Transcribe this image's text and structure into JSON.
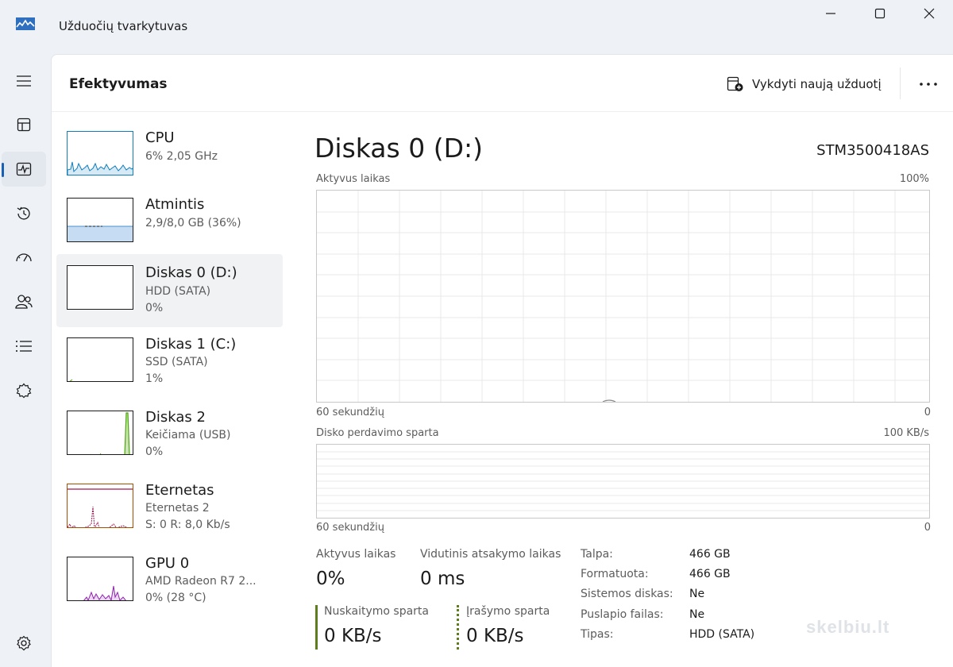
{
  "app": {
    "title": "Užduočių tvarkytuvas",
    "accent_color": "#1a5fb4"
  },
  "window_controls": {
    "minimize_icon": "minimize-icon",
    "maximize_icon": "maximize-icon",
    "close_icon": "close-icon"
  },
  "nav": {
    "items": [
      {
        "icon": "hamburger-menu-icon"
      },
      {
        "icon": "processes-icon"
      },
      {
        "icon": "performance-icon",
        "active": true
      },
      {
        "icon": "app-history-icon"
      },
      {
        "icon": "startup-apps-icon"
      },
      {
        "icon": "users-icon"
      },
      {
        "icon": "details-icon"
      },
      {
        "icon": "services-icon"
      },
      {
        "icon": "settings-icon"
      }
    ]
  },
  "header": {
    "title": "Efektyvumas",
    "run_task_label": "Vykdyti naują užduotį",
    "more_label": "···"
  },
  "devices": [
    {
      "name": "CPU",
      "sub1": "6% 2,05 GHz",
      "sub2": "",
      "color": "#117dbb"
    },
    {
      "name": "Atmintis",
      "sub1": "2,9/8,0 GB (36%)",
      "sub2": "",
      "color": "#8b12ae"
    },
    {
      "name": "Diskas 0 (D:)",
      "sub1": "HDD (SATA)",
      "sub2": "0%",
      "color": "#4da60c",
      "selected": true
    },
    {
      "name": "Diskas 1 (C:)",
      "sub1": "SSD (SATA)",
      "sub2": "1%",
      "color": "#4da60c"
    },
    {
      "name": "Diskas 2",
      "sub1": "Keičiama (USB)",
      "sub2": "0%",
      "color": "#4da60c"
    },
    {
      "name": "Eternetas",
      "sub1": "Eternetas 2",
      "sub2": "S: 0 R: 8,0 Kb/s",
      "color": "#a74f01"
    },
    {
      "name": "GPU 0",
      "sub1": "AMD Radeon R7 2...",
      "sub2": "0% (28 °C)",
      "color": "#8e24aa"
    }
  ],
  "detail": {
    "title": "Diskas 0 (D:)",
    "model": "STM3500418AS",
    "graph1": {
      "label": "Aktyvus laikas",
      "max": "100%",
      "x_left": "60 sekundžių",
      "x_right": "0"
    },
    "graph2": {
      "label": "Disko perdavimo sparta",
      "max": "100 KB/s",
      "x_left": "60 sekundžių",
      "x_right": "0"
    },
    "stats": {
      "active_time_label": "Aktyvus laikas",
      "active_time_value": "0%",
      "avg_response_label": "Vidutinis atsakymo laikas",
      "avg_response_value": "0 ms",
      "read_speed_label": "Nuskaitymo sparta",
      "read_speed_value": "0 KB/s",
      "write_speed_label": "Įrašymo sparta",
      "write_speed_value": "0 KB/s"
    },
    "properties": [
      {
        "label": "Talpa:",
        "value": "466 GB"
      },
      {
        "label": "Formatuota:",
        "value": "466 GB"
      },
      {
        "label": "Sistemos diskas:",
        "value": "Ne"
      },
      {
        "label": "Puslapio failas:",
        "value": "Ne"
      },
      {
        "label": "Tipas:",
        "value": "HDD (SATA)"
      }
    ]
  },
  "watermark": "skelbiu.lt"
}
